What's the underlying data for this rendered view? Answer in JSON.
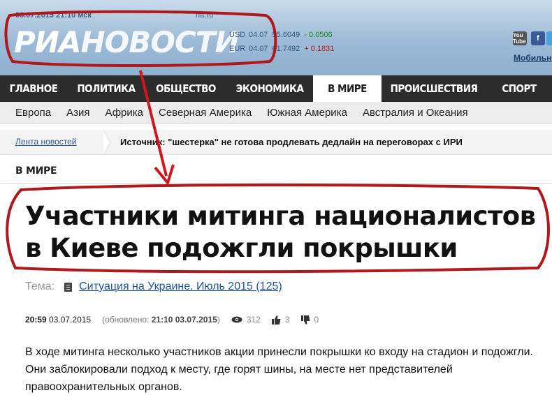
{
  "header": {
    "date_time": "03.07.2015 21:10 мск",
    "site": "ria.ru",
    "logo_ria": "РИА",
    "logo_novosti": "НОВОСТИ",
    "rates": [
      {
        "code": "USD",
        "date": "04.07",
        "value": "55.6049",
        "change": "- 0.0506",
        "dir": "down-green"
      },
      {
        "code": "EUR",
        "date": "04.07",
        "value": "61.7492",
        "change": "+ 0.1831",
        "dir": "up-red"
      }
    ],
    "social": [
      "youtube-icon",
      "facebook-icon",
      "twitter-icon"
    ],
    "youtube_text": "You Tube",
    "mobile_link": "Мобильн"
  },
  "nav": {
    "items": [
      {
        "label": "ГЛАВНОЕ",
        "active": false
      },
      {
        "label": "ПОЛИТИКА",
        "active": false
      },
      {
        "label": "ОБЩЕСТВО",
        "active": false
      },
      {
        "label": "ЭКОНОМИКА",
        "active": false
      },
      {
        "label": "В МИРЕ",
        "active": true
      },
      {
        "label": "ПРОИСШЕСТВИЯ",
        "active": false
      },
      {
        "label": "СПОРТ",
        "active": false
      }
    ]
  },
  "subnav": {
    "items": [
      "Европа",
      "Азия",
      "Африка",
      "Северная Америка",
      "Южная Америка",
      "Австралия и Океания"
    ]
  },
  "ticker": {
    "link": "Лента новостей",
    "text": "Источник: \"шестерка\" не готова продлевать дедлайн на переговорах с ИРИ"
  },
  "section": "В МИРЕ",
  "article": {
    "title": "Участники митинга националистов в Киеве подожгли покрышки",
    "theme_label": "Тема:",
    "theme_link": "Ситуация на Украине. Июль 2015 (125)",
    "time": "20:59",
    "date": "03.07.2015",
    "updated_prefix": "(обновлено:",
    "updated_value": "21:10 03.07.2015",
    "updated_suffix": ")",
    "views": "312",
    "likes": "3",
    "dislikes": "0",
    "body": "В ходе митинга несколько участников акции принесли покрышки ко входу на стадион и подожгли. Они заблокировали подход к месту, где горят шины, на месте нет представителей правоохранительных органов."
  },
  "colors": {
    "annotation": "#b0191c",
    "nav_bg": "#2c2c2c",
    "link": "#1f5496"
  }
}
